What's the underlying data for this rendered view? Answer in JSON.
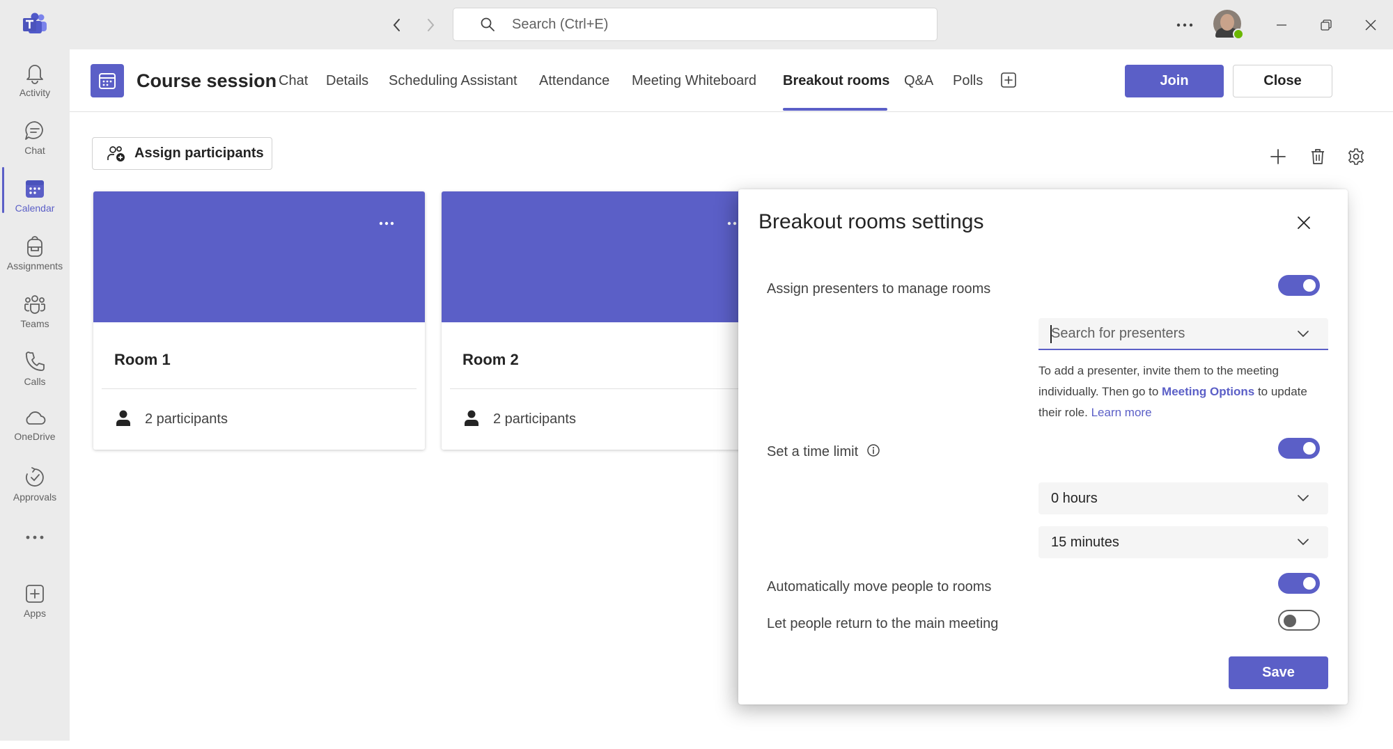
{
  "titlebar": {
    "search_placeholder": "Search (Ctrl+E)",
    "accent": "#5b5fc7",
    "presence_status_color": "#6bb700"
  },
  "rail": {
    "items": [
      {
        "label": "Activity",
        "icon": "bell-icon"
      },
      {
        "label": "Chat",
        "icon": "chat-icon"
      },
      {
        "label": "Calendar",
        "icon": "calendar-icon",
        "active": true
      },
      {
        "label": "Assignments",
        "icon": "backpack-icon"
      },
      {
        "label": "Teams",
        "icon": "teams-icon"
      },
      {
        "label": "Calls",
        "icon": "phone-icon"
      },
      {
        "label": "OneDrive",
        "icon": "cloud-icon"
      },
      {
        "label": "Approvals",
        "icon": "approvals-icon"
      },
      {
        "label": "",
        "icon": "more-apps-icon"
      },
      {
        "label": "Apps",
        "icon": "add-apps-icon"
      }
    ]
  },
  "header": {
    "title": "Course session",
    "tabs": [
      {
        "label": "Chat"
      },
      {
        "label": "Details"
      },
      {
        "label": "Scheduling Assistant"
      },
      {
        "label": "Attendance"
      },
      {
        "label": "Meeting Whiteboard"
      },
      {
        "label": "Breakout rooms",
        "active": true
      },
      {
        "label": "Q&A"
      },
      {
        "label": "Polls"
      }
    ],
    "join_label": "Join",
    "close_label": "Close"
  },
  "toolbar": {
    "assign_label": "Assign participants"
  },
  "rooms": [
    {
      "name": "Room 1",
      "participants": "2 participants"
    },
    {
      "name": "Room 2",
      "participants": "2 participants"
    }
  ],
  "settings": {
    "title": "Breakout rooms settings",
    "assign_presenters_label": "Assign presenters to manage rooms",
    "assign_presenters_on": true,
    "presenter_search_placeholder": "Search for presenters",
    "help_before": "To add a presenter, invite them to the meeting individually. Then go to ",
    "help_link_options": "Meeting Options",
    "help_after": " to update their role. ",
    "help_link_learn": "Learn more",
    "time_limit_label": "Set a time limit",
    "time_limit_on": true,
    "hours_value": "0 hours",
    "minutes_value": "15 minutes",
    "auto_move_label": "Automatically move people to rooms",
    "auto_move_on": true,
    "return_label": "Let people return to the main meeting",
    "return_on": false,
    "save_label": "Save"
  }
}
